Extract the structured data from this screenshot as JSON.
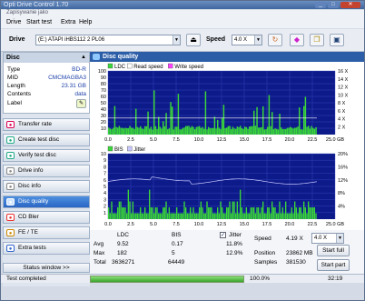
{
  "window": {
    "title": "Opti Drive Control 1.70",
    "subtitle": "Zapisywanie jako"
  },
  "menu": [
    "Drive",
    "Start test",
    "Extra",
    "Help"
  ],
  "drivebar": {
    "drive_label": "Drive",
    "drive_value": "(E:)  ATAPI iHBS112   2 PL06",
    "speed_label": "Speed",
    "speed_value": "4.0 X"
  },
  "disc": {
    "header": "Disc",
    "rows": [
      {
        "key": "Type",
        "value": "BD-R"
      },
      {
        "key": "MID",
        "value": "CMCMAGBA3"
      },
      {
        "key": "Length",
        "value": "23.31 GB"
      },
      {
        "key": "Contents",
        "value": "data"
      },
      {
        "key": "Label",
        "value": ""
      }
    ]
  },
  "nav": [
    {
      "label": "Transfer rate",
      "icon": "transfer-icon",
      "active": false
    },
    {
      "label": "Create test disc",
      "icon": "create-disc-icon",
      "active": false
    },
    {
      "label": "Verify test disc",
      "icon": "verify-disc-icon",
      "active": false
    },
    {
      "label": "Drive info",
      "icon": "drive-info-icon",
      "active": false
    },
    {
      "label": "Disc info",
      "icon": "disc-info-icon",
      "active": false
    },
    {
      "label": "Disc quality",
      "icon": "disc-quality-icon",
      "active": true
    },
    {
      "label": "CD Bler",
      "icon": "cd-bler-icon",
      "active": false
    },
    {
      "label": "FE / TE",
      "icon": "fe-te-icon",
      "active": false
    },
    {
      "label": "Extra tests",
      "icon": "extra-tests-icon",
      "active": false
    }
  ],
  "status_window_label": "Status window >>",
  "panel_title": "Disc quality",
  "chart_data": [
    {
      "type": "bar",
      "legend": [
        "LDC",
        "Read speed",
        "Write speed"
      ],
      "x_ticks": [
        "0.0",
        "2.5",
        "5.0",
        "7.5",
        "10.0",
        "12.5",
        "15.0",
        "17.5",
        "20.0",
        "22.5",
        "25.0 GB"
      ],
      "y_left_ticks": [
        "100",
        "90",
        "80",
        "70",
        "60",
        "50",
        "40",
        "30",
        "20",
        "10"
      ],
      "y_right_ticks": [
        "16 X",
        "14 X",
        "12 X",
        "10 X",
        "8 X",
        "6 X",
        "4 X",
        "2 X"
      ],
      "xlim": [
        0,
        25
      ],
      "ylim": [
        0,
        100
      ],
      "colors": {
        "ldc": "#3ad63a",
        "read": "#ffffff",
        "write": "#ff40ff",
        "bg": "#0d1a8a"
      }
    },
    {
      "type": "bar",
      "legend": [
        "BIS",
        "Jitter"
      ],
      "x_ticks": [
        "0.0",
        "2.5",
        "5.0",
        "7.5",
        "10.0",
        "12.5",
        "15.0",
        "17.5",
        "20.0",
        "22.5",
        "25.0 GB"
      ],
      "y_left_ticks": [
        "10",
        "9",
        "8",
        "7",
        "6",
        "5",
        "4",
        "3",
        "2",
        "1"
      ],
      "y_right_ticks": [
        "20%",
        "16%",
        "12%",
        "8%",
        "4%"
      ],
      "xlim": [
        0,
        25
      ],
      "ylim": [
        0,
        10
      ],
      "colors": {
        "bis": "#3ad63a",
        "jitter": "#c8c8ff",
        "bg": "#0d1a8a"
      }
    }
  ],
  "stats": {
    "col_ldc": "LDC",
    "col_bis": "BIS",
    "jitter_label": "Jitter",
    "rows": [
      {
        "name": "Avg",
        "ldc": "9.52",
        "bis": "0.17",
        "jitter": "11.8%"
      },
      {
        "name": "Max",
        "ldc": "182",
        "bis": "5",
        "jitter": "12.9%"
      },
      {
        "name": "Total",
        "ldc": "3636271",
        "bis": "64449",
        "jitter": ""
      }
    ],
    "speed_label": "Speed",
    "speed_value": "4.19 X",
    "speed_select": "4.0 X",
    "position_label": "Position",
    "position_value": "23862 MB",
    "samples_label": "Samples",
    "samples_value": "381530",
    "start_full": "Start full",
    "start_part": "Start part"
  },
  "status": {
    "text": "Test completed",
    "percent": "100.0%",
    "progress": 1.0,
    "time": "32:19"
  }
}
